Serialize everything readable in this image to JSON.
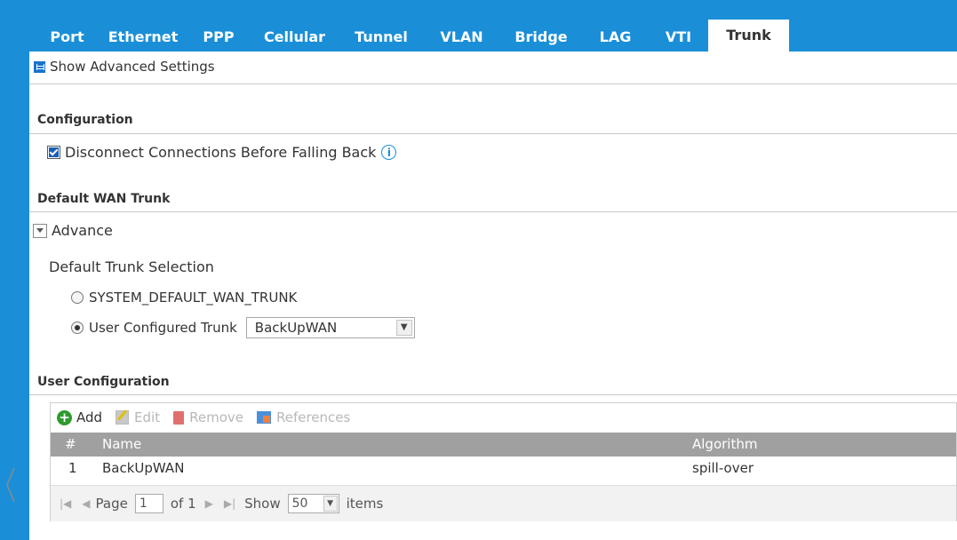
{
  "tabs": [
    {
      "label": "Port",
      "active": false
    },
    {
      "label": "Ethernet",
      "active": false
    },
    {
      "label": "PPP",
      "active": false
    },
    {
      "label": "Cellular",
      "active": false
    },
    {
      "label": "Tunnel",
      "active": false
    },
    {
      "label": "VLAN",
      "active": false
    },
    {
      "label": "Bridge",
      "active": false
    },
    {
      "label": "LAG",
      "active": false
    },
    {
      "label": "VTI",
      "active": false
    },
    {
      "label": "Trunk",
      "active": true
    }
  ],
  "advanced": {
    "label": "Show Advanced Settings"
  },
  "configuration": {
    "title": "Configuration",
    "disconnect_label": "Disconnect Connections Before Falling Back",
    "disconnect_checked": true
  },
  "default_wan": {
    "title": "Default WAN Trunk",
    "advance_label": "Advance",
    "selection_label": "Default Trunk Selection",
    "option_system": "SYSTEM_DEFAULT_WAN_TRUNK",
    "option_user": "User Configured Trunk",
    "selected_option": "User Configured Trunk",
    "trunk_value": "BackUpWAN"
  },
  "user_config": {
    "title": "User Configuration",
    "toolbar": {
      "add": "Add",
      "edit": "Edit",
      "remove": "Remove",
      "references": "References"
    },
    "columns": {
      "num": "#",
      "name": "Name",
      "algorithm": "Algorithm"
    },
    "rows": [
      {
        "num": "1",
        "name": "BackUpWAN",
        "algorithm": "spill-over"
      }
    ],
    "pager": {
      "page_label": "Page",
      "page_value": "1",
      "of_label": "of 1",
      "show_label": "Show",
      "show_value": "50",
      "items_label": "items"
    }
  },
  "colors": {
    "accent": "#1a8fd8",
    "header_gray": "#a0a0a0",
    "add_green": "#2e9a2e"
  }
}
